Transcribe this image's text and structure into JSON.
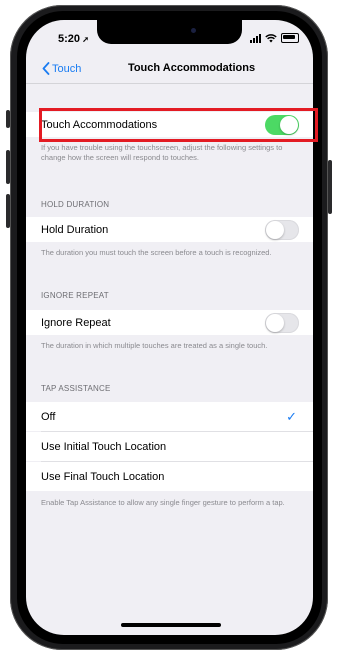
{
  "status": {
    "time": "5:20"
  },
  "nav": {
    "back_label": "Touch",
    "title": "Touch Accommodations"
  },
  "main": {
    "touch_accommodations": {
      "label": "Touch Accommodations",
      "enabled": true
    },
    "touch_accommodations_footer": "If you have trouble using the touchscreen, adjust the following settings to change how the screen will respond to touches.",
    "hold_duration": {
      "header": "HOLD DURATION",
      "label": "Hold Duration",
      "enabled": false,
      "footer": "The duration you must touch the screen before a touch is recognized."
    },
    "ignore_repeat": {
      "header": "IGNORE REPEAT",
      "label": "Ignore Repeat",
      "enabled": false,
      "footer": "The duration in which multiple touches are treated as a single touch."
    },
    "tap_assistance": {
      "header": "TAP ASSISTANCE",
      "options": [
        "Off",
        "Use Initial Touch Location",
        "Use Final Touch Location"
      ],
      "selected": "Off",
      "footer": "Enable Tap Assistance to allow any single finger gesture to perform a tap."
    }
  },
  "colors": {
    "accent": "#1a7cf2",
    "toggle_on": "#4cd964",
    "highlight": "#e31b23",
    "background": "#f0eff4"
  }
}
